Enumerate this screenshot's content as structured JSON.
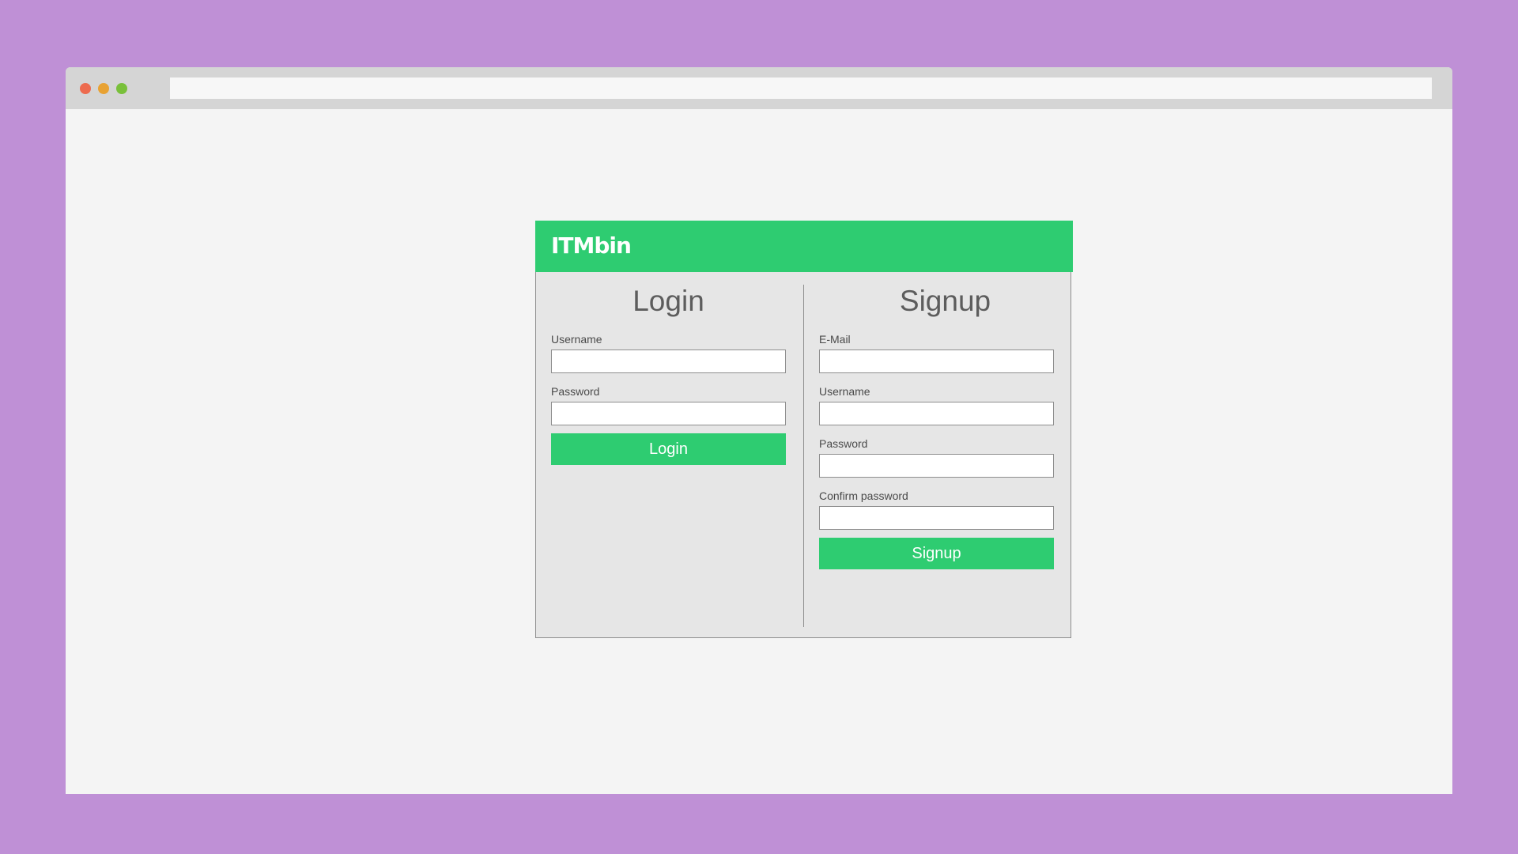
{
  "browser": {
    "window_buttons": [
      {
        "name": "close",
        "color": "#ed6b4f"
      },
      {
        "name": "minimize",
        "color": "#e8a233"
      },
      {
        "name": "maximize",
        "color": "#79c03a"
      }
    ],
    "address_bar": {
      "value": ""
    }
  },
  "header": {
    "logo": "ITMbin",
    "color": "#2ecc71"
  },
  "login": {
    "title": "Login",
    "username_label": "Username",
    "password_label": "Password",
    "submit_label": "Login"
  },
  "signup": {
    "title": "Signup",
    "email_label": "E-Mail",
    "username_label": "Username",
    "password_label": "Password",
    "confirm_label": "Confirm password",
    "submit_label": "Signup"
  }
}
